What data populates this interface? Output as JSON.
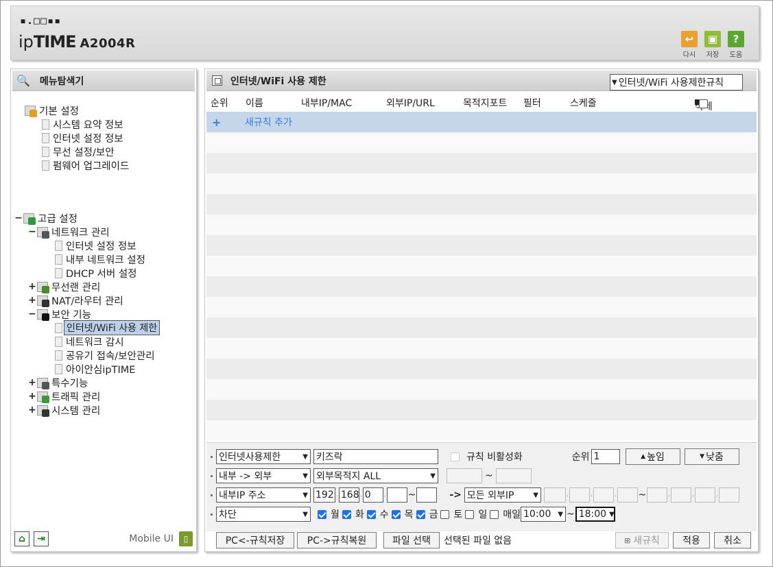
{
  "header": {
    "brand_dots": "▪.□□▪▪",
    "brand_ip": "ip",
    "brand_time": "TIME",
    "model": "A2004R",
    "buttons": [
      {
        "label": "다시",
        "icon": "undo-icon",
        "glyph": "↩",
        "color": "#e8a030"
      },
      {
        "label": "저장",
        "icon": "save-icon",
        "glyph": "▣",
        "color": "#8fbc3a"
      },
      {
        "label": "도움",
        "icon": "help-icon",
        "glyph": "?",
        "color": "#5aa832"
      }
    ]
  },
  "left": {
    "title": "메뉴탐색기",
    "basic": {
      "label": "기본 설정",
      "items": [
        "시스템 요약 정보",
        "인터넷 설정 정보",
        "무선 설정/보안",
        "펌웨어 업그레이드"
      ]
    },
    "advanced": {
      "toggle": "−",
      "label": "고급 설정",
      "network": {
        "toggle": "−",
        "label": "네트워크 관리",
        "items": [
          "인터넷 설정 정보",
          "내부 네트워크 설정",
          "DHCP 서버 설정"
        ]
      },
      "wireless": {
        "toggle": "+",
        "label": "무선랜 관리"
      },
      "nat": {
        "toggle": "+",
        "label": "NAT/라우터 관리"
      },
      "security": {
        "toggle": "−",
        "label": "보안 기능",
        "items": [
          "인터넷/WiFi 사용 제한",
          "네트워크 감시",
          "공유기 접속/보안관리",
          "아이안심ipTIME"
        ],
        "selected_index": 0
      },
      "special": {
        "toggle": "+",
        "label": "특수기능"
      },
      "traffic": {
        "toggle": "+",
        "label": "트래픽 관리"
      },
      "system": {
        "toggle": "+",
        "label": "시스템 관리"
      }
    },
    "bottom": {
      "mobile_label": "Mobile UI"
    }
  },
  "right": {
    "title": "인터넷/WiFi 사용 제한",
    "rule_select": "인터넷/WiFi 사용제한규칙",
    "columns": {
      "order": "순위",
      "name": "이름",
      "internal": "내부IP/MAC",
      "external": "외부IP/URL",
      "port": "목적지포트",
      "filter": "필터",
      "schedule": "스케줄",
      "delete": "삭제"
    },
    "add_rule": "새규칙 추가",
    "form": {
      "rule_type": "인터넷사용제한",
      "rule_name": "키즈락",
      "disable_label": "규칙 비활성화",
      "order_label": "순위",
      "order_value": "1",
      "up_label": "높임",
      "down_label": "낮춤",
      "direction": "내부 -> 외부",
      "destination": "외부목적지 ALL",
      "tilde": "~",
      "internal_type": "내부IP 주소",
      "ip": [
        "192",
        "168",
        "0",
        ""
      ],
      "ip_end": "",
      "arrow": "->",
      "external_type": "모든 외부IP",
      "action": "차단",
      "days": [
        {
          "label": "월",
          "checked": true
        },
        {
          "label": "화",
          "checked": true
        },
        {
          "label": "수",
          "checked": true
        },
        {
          "label": "목",
          "checked": true
        },
        {
          "label": "금",
          "checked": true
        },
        {
          "label": "토",
          "checked": false
        },
        {
          "label": "일",
          "checked": false
        },
        {
          "label": "매일",
          "checked": false
        }
      ],
      "time_start": "10:00",
      "time_end": "18:00"
    },
    "bottom": {
      "save_pc": "PC<-규칙저장",
      "restore_pc": "PC->규칙복원",
      "file_select": "파일 선택",
      "no_file": "선택된 파일 없음",
      "new_rule": "새규칙",
      "apply": "적용",
      "cancel": "취소"
    }
  }
}
